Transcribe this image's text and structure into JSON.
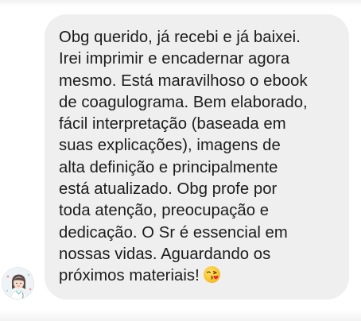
{
  "chat": {
    "message": {
      "lines": [
        "Obg querido, já recebi e já baixei.",
        "Irei imprimir e encadernar agora",
        "mesmo. Está maravilhoso o ebook",
        "de coagulograma. Bem elaborado,",
        "fácil interpretação (baseada em",
        "suas explicações), imagens de",
        "alta definição e principalmente",
        "está atualizado. Obg profe por",
        "toda atenção, preocupação e",
        "dedicação. O Sr é essencial em",
        "nossas vidas. Aguardando os",
        "próximos materiais!"
      ],
      "emoji": "face-blowing-a-kiss-emoji"
    },
    "sender": {
      "avatar_icon": "user-avatar-illustration"
    }
  },
  "colors": {
    "bubble_background": "#efefef",
    "text": "#1c1c1c",
    "page_background": "#ffffff"
  }
}
